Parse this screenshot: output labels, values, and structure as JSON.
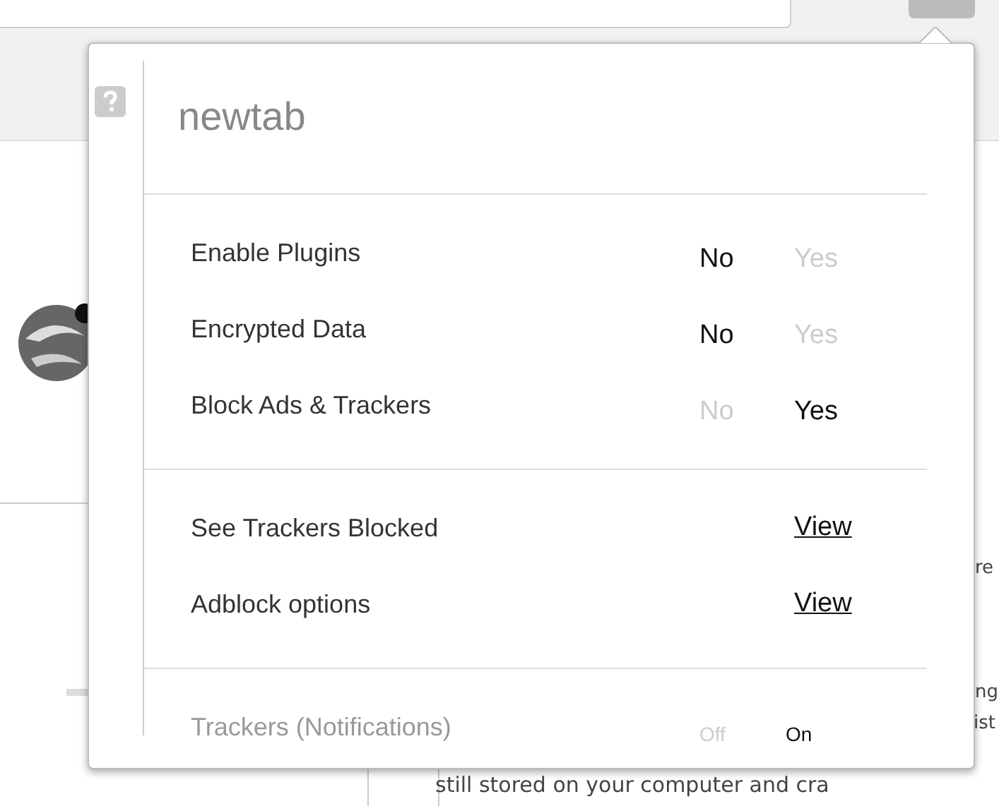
{
  "popup": {
    "title": "newtab",
    "sections": [
      {
        "rows": [
          {
            "kind": "toggle",
            "label": "Enable Plugins",
            "disabled": false,
            "options": [
              {
                "label": "No",
                "selected": true
              },
              {
                "label": "Yes",
                "selected": false
              }
            ]
          },
          {
            "kind": "toggle",
            "label": "Encrypted Data",
            "disabled": false,
            "options": [
              {
                "label": "No",
                "selected": true
              },
              {
                "label": "Yes",
                "selected": false
              }
            ]
          },
          {
            "kind": "toggle",
            "label": "Block Ads & Trackers",
            "disabled": false,
            "options": [
              {
                "label": "No",
                "selected": false
              },
              {
                "label": "Yes",
                "selected": true
              }
            ]
          }
        ]
      },
      {
        "rows": [
          {
            "kind": "link",
            "label": "See Trackers Blocked",
            "disabled": false,
            "link": "View"
          },
          {
            "kind": "link",
            "label": "Adblock options",
            "disabled": false,
            "link": "View"
          }
        ]
      },
      {
        "rows": [
          {
            "kind": "small-toggle",
            "label": "Trackers (Notifications)",
            "disabled": true,
            "options": [
              {
                "label": "Off",
                "selected": false
              },
              {
                "label": "On",
                "selected": true
              }
            ]
          }
        ]
      }
    ]
  },
  "background_page": {
    "texts": [
      {
        "text": "re"
      },
      {
        "text": "ng"
      },
      {
        "text": "ist"
      },
      {
        "text": "still stored on your computer and cra"
      }
    ]
  }
}
